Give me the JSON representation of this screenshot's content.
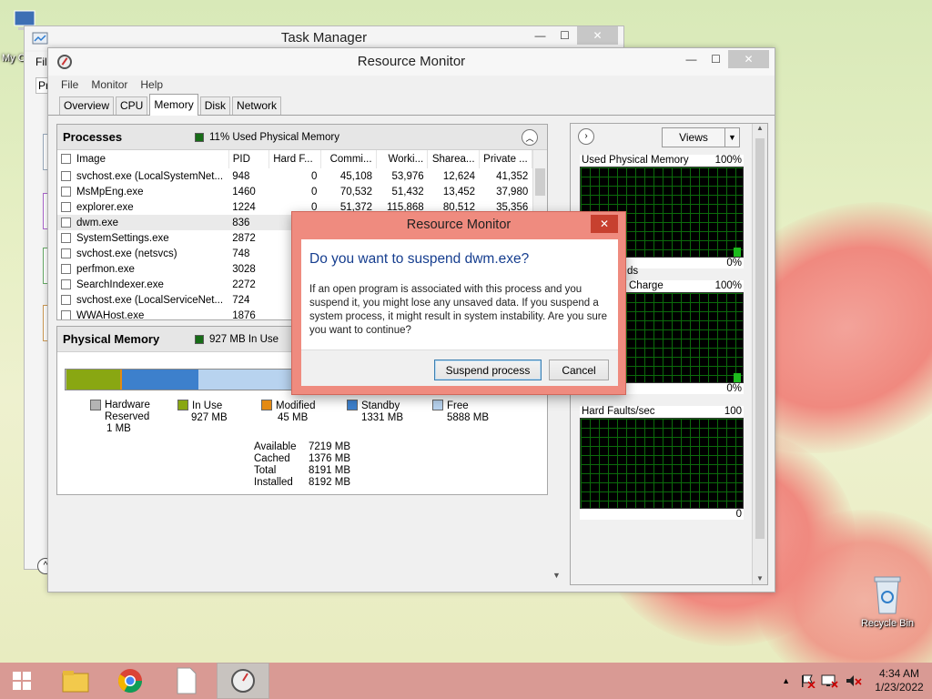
{
  "taskmanager": {
    "title": "Task Manager",
    "menu_partial": "Fil",
    "tab_partial": "Pr"
  },
  "desktop": {
    "my_computer_partial": "My C",
    "recycle_bin": "Recycle Bin"
  },
  "resmon": {
    "title": "Resource Monitor",
    "menu": [
      "File",
      "Monitor",
      "Help"
    ],
    "tabs": [
      "Overview",
      "CPU",
      "Memory",
      "Disk",
      "Network"
    ],
    "active_tab": "Memory",
    "processes": {
      "title": "Processes",
      "summary": "11% Used Physical Memory",
      "columns": [
        "Image",
        "PID",
        "Hard F...",
        "Commi...",
        "Worki...",
        "Sharea...",
        "Private ..."
      ],
      "rows": [
        [
          "svchost.exe (LocalSystemNet...",
          "948",
          "0",
          "45,108",
          "53,976",
          "12,624",
          "41,352"
        ],
        [
          "MsMpEng.exe",
          "1460",
          "0",
          "70,532",
          "51,432",
          "13,452",
          "37,980"
        ],
        [
          "explorer.exe",
          "1224",
          "0",
          "51,372",
          "115,868",
          "80,512",
          "35,356"
        ],
        [
          "dwm.exe",
          "836",
          "",
          "",
          "",
          "",
          ""
        ],
        [
          "SystemSettings.exe",
          "2872",
          "",
          "",
          "",
          "",
          ""
        ],
        [
          "svchost.exe (netsvcs)",
          "748",
          "",
          "",
          "",
          "",
          ""
        ],
        [
          "perfmon.exe",
          "3028",
          "",
          "",
          "",
          "",
          ""
        ],
        [
          "SearchIndexer.exe",
          "2272",
          "",
          "",
          "",
          "",
          ""
        ],
        [
          "svchost.exe (LocalServiceNet...",
          "724",
          "",
          "",
          "",
          "",
          ""
        ],
        [
          "WWAHost.exe",
          "1876",
          "",
          "",
          "",
          "",
          ""
        ]
      ]
    },
    "physical_memory": {
      "title": "Physical Memory",
      "summary": "927 MB In Use",
      "bar_mb": {
        "hardware_reserved": 1,
        "in_use": 927,
        "modified": 45,
        "standby": 1331,
        "free": 5888
      },
      "legend": [
        {
          "label": "Hardware Reserved",
          "value": "1 MB",
          "color": "#b4b4b4"
        },
        {
          "label": "In Use",
          "value": "927 MB",
          "color": "#89a712"
        },
        {
          "label": "Modified",
          "value": "45 MB",
          "color": "#e48a13"
        },
        {
          "label": "Standby",
          "value": "1331 MB",
          "color": "#3d80cc"
        },
        {
          "label": "Free",
          "value": "5888 MB",
          "color": "#b8d3ef"
        }
      ],
      "stats": [
        {
          "label": "Available",
          "value": "7219 MB"
        },
        {
          "label": "Cached",
          "value": "1376 MB"
        },
        {
          "label": "Total",
          "value": "8191 MB"
        },
        {
          "label": "Installed",
          "value": "8192 MB"
        }
      ]
    },
    "graphs": {
      "views_label": "Views",
      "items": [
        {
          "title": "Used Physical Memory",
          "max": "100%",
          "min": "0%"
        },
        {
          "title": "Commit Charge",
          "title_visible": "Charge",
          "max": "100%",
          "min": "0%",
          "prev_partial": "ds"
        },
        {
          "title": "Hard Faults/sec",
          "max": "100",
          "min": "0"
        }
      ]
    }
  },
  "dialog": {
    "title": "Resource Monitor",
    "question": "Do you want to suspend dwm.exe?",
    "message": "If an open program is associated with this process and you suspend it, you might lose any unsaved data. If you suspend a system process, it might result in system instability. Are you sure you want to continue?",
    "confirm_label": "Suspend process",
    "cancel_label": "Cancel",
    "close_glyph": "✕"
  },
  "taskbar": {
    "time": "4:34 AM",
    "date": "1/23/2022"
  },
  "colors": {
    "accent_dialog": "#ef8b7f",
    "taskbar": "#d99a94",
    "graph_grid": "#0b6b0b"
  }
}
